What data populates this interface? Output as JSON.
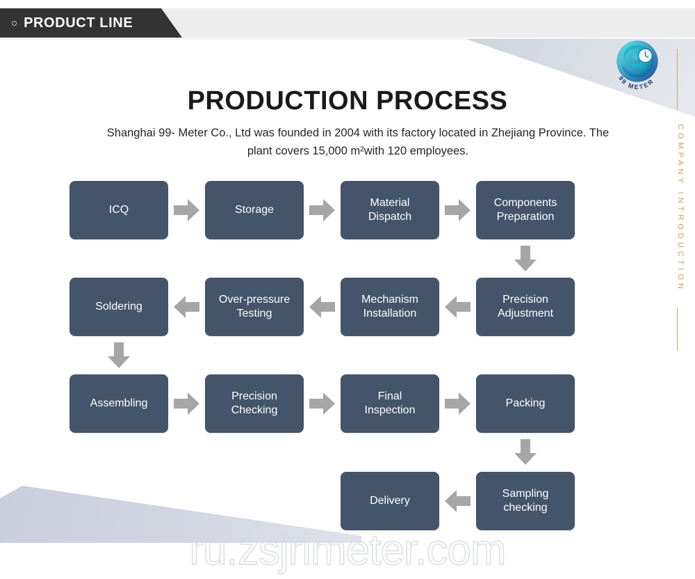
{
  "banner": {
    "bullet_icon": "circle-outline-icon",
    "label": "PRODUCT LINE"
  },
  "brand": {
    "logo_name": "99-meter-logo",
    "logo_text": "99 METER",
    "accent_color": "#c2a25e",
    "node_color": "#44546A",
    "arrow_color": "#A6A6A6",
    "banner_color": "#333333"
  },
  "side_rail": {
    "vertical_text": "COMPANY INTRODUCTION"
  },
  "heading": {
    "title": "PRODUCTION PROCESS",
    "subtitle": "Shanghai 99- Meter Co., Ltd was founded in 2004 with its factory located in Zhejiang Province. The plant covers 15,000 m²with 120 employees."
  },
  "diagram": {
    "nodes": [
      {
        "id": "icq",
        "label": "ICQ"
      },
      {
        "id": "storage",
        "label": "Storage"
      },
      {
        "id": "material-dispatch",
        "label": "Material\nDispatch"
      },
      {
        "id": "components-preparation",
        "label": "Components\nPreparation"
      },
      {
        "id": "precision-adjustment",
        "label": "Precision\nAdjustment"
      },
      {
        "id": "mechanism-installation",
        "label": "Mechanism\nInstallation"
      },
      {
        "id": "over-pressure-testing",
        "label": "Over-pressure\nTesting"
      },
      {
        "id": "soldering",
        "label": "Soldering"
      },
      {
        "id": "assembling",
        "label": "Assembling"
      },
      {
        "id": "precision-checking",
        "label": "Precision\nChecking"
      },
      {
        "id": "final-inspection",
        "label": "Final\nInspection"
      },
      {
        "id": "packing",
        "label": "Packing"
      },
      {
        "id": "sampling-checking",
        "label": "Sampling\nchecking"
      },
      {
        "id": "delivery",
        "label": "Delivery"
      }
    ],
    "connectors": [
      {
        "from": "icq",
        "to": "storage",
        "direction": "right"
      },
      {
        "from": "storage",
        "to": "material-dispatch",
        "direction": "right"
      },
      {
        "from": "material-dispatch",
        "to": "components-preparation",
        "direction": "right"
      },
      {
        "from": "components-preparation",
        "to": "precision-adjustment",
        "direction": "down"
      },
      {
        "from": "precision-adjustment",
        "to": "mechanism-installation",
        "direction": "left"
      },
      {
        "from": "mechanism-installation",
        "to": "over-pressure-testing",
        "direction": "left"
      },
      {
        "from": "over-pressure-testing",
        "to": "soldering",
        "direction": "left"
      },
      {
        "from": "soldering",
        "to": "assembling",
        "direction": "down"
      },
      {
        "from": "assembling",
        "to": "precision-checking",
        "direction": "right"
      },
      {
        "from": "precision-checking",
        "to": "final-inspection",
        "direction": "right"
      },
      {
        "from": "final-inspection",
        "to": "packing",
        "direction": "right"
      },
      {
        "from": "packing",
        "to": "sampling-checking",
        "direction": "down"
      },
      {
        "from": "sampling-checking",
        "to": "delivery",
        "direction": "left"
      }
    ]
  },
  "watermark": {
    "text": "ru.zsjrlmeter.com"
  }
}
